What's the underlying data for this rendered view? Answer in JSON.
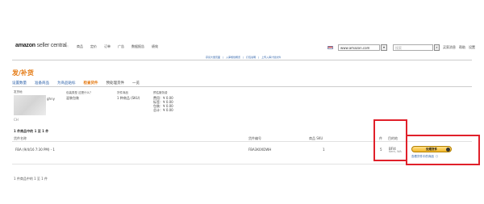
{
  "header": {
    "logo_brand": "amazon",
    "logo_sub": "seller central",
    "nav": [
      "商品",
      "定价",
      "订单",
      "广告",
      "数据报告",
      "绩效"
    ],
    "marketplace": "www.amazon.com",
    "search_placeholder": "搜索",
    "util": [
      "买家消息",
      "帮助",
      "设置"
    ],
    "links": [
      "存货大量页面",
      "入库规划概览",
      "打包说明",
      "上传入库计划文件"
    ]
  },
  "page": {
    "title": "发/补货",
    "steps": [
      {
        "label": "设置数量",
        "state": "done"
      },
      {
        "label": "准备商品",
        "state": "done"
      },
      {
        "label": "为商品贴标",
        "state": "done"
      },
      {
        "label": "检查货件",
        "state": "active"
      },
      {
        "label": "预处理货件",
        "state": "plain"
      },
      {
        "label": "一览",
        "state": "plain"
      }
    ]
  },
  "summary": {
    "ship_from_label": "发货地",
    "ship_from_value": "ghny",
    "packing_label": "包装类型 这是什么？",
    "packing_value": "混装包装",
    "contents_label": "货件商品",
    "contents_value": "1 种商品 (SKU)",
    "fees_label": "预估服务费",
    "fees": [
      "费用：¥ 0.00",
      "标签：¥ 0.00",
      "包装：¥ 0.00",
      "总计：¥ 0.00"
    ],
    "ship_from_extra": "CH"
  },
  "table": {
    "count_text": "1 件商品中的 1 至 1 件",
    "headers": [
      "货件名称",
      "货件编号",
      "商品 SKU",
      "件",
      "目的地"
    ],
    "rows": [
      {
        "name": "FBA (9/4/16 7:30 PM) - 1",
        "id": "FBA3K0XDWH",
        "skus": "1",
        "units": "5",
        "dest": "BFI4",
        "dest_sub": "Kent, WA"
      }
    ],
    "footer_count": "1 件商品中的 1 至 1 件"
  },
  "actions": {
    "approve_button": "处理货件",
    "view_link": "查看货件中的商品（）"
  }
}
